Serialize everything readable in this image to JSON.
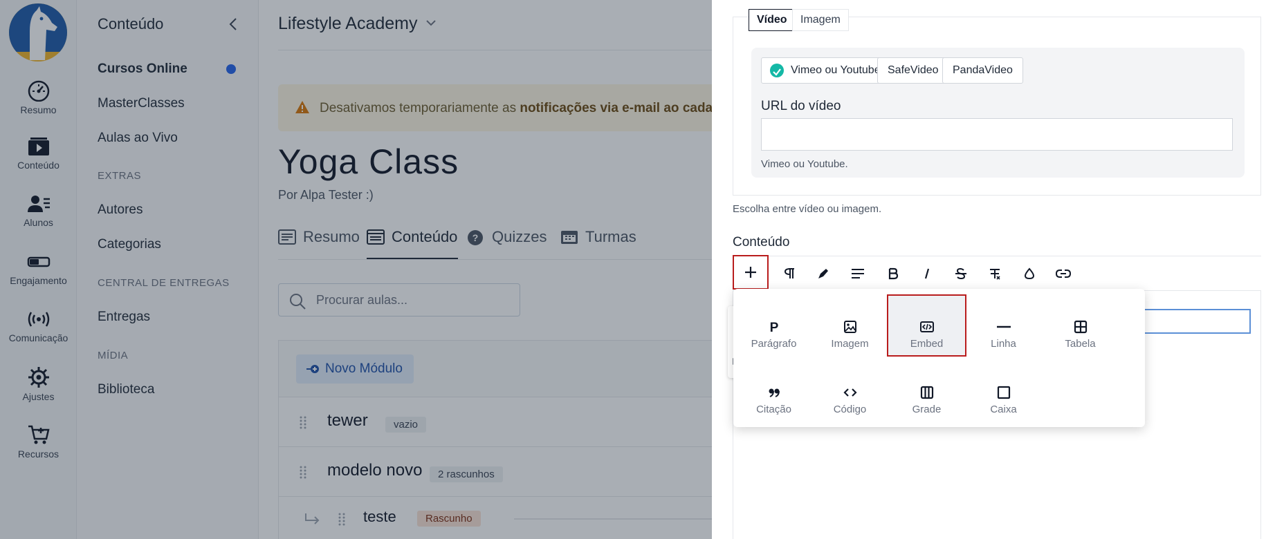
{
  "rail": {
    "items": [
      {
        "label": "Resumo",
        "icon": "gauge-icon"
      },
      {
        "label": "Conteúdo",
        "icon": "video-folder-icon"
      },
      {
        "label": "Alunos",
        "icon": "users-icon"
      },
      {
        "label": "Engajamento",
        "icon": "toggle-icon"
      },
      {
        "label": "Comunicação",
        "icon": "broadcast-icon"
      },
      {
        "label": "Ajustes",
        "icon": "gear-icon"
      },
      {
        "label": "Recursos",
        "icon": "cart-plus-icon"
      }
    ]
  },
  "sidebar": {
    "title": "Conteúdo",
    "links": [
      "Cursos Online",
      "MasterClasses",
      "Aulas ao Vivo"
    ],
    "extras_title": "EXTRAS",
    "extras": [
      "Autores",
      "Categorias"
    ],
    "central_title": "CENTRAL DE ENTREGAS",
    "central": [
      "Entregas"
    ],
    "midia_title": "MÍDIA",
    "midia": [
      "Biblioteca"
    ],
    "active_color": "#2563eb"
  },
  "main": {
    "academy": "Lifestyle Academy",
    "alert_prefix": "Desativamos temporariamente as ",
    "alert_bold": "notificações via e-mail ao cadastr",
    "course_title": "Yoga Class",
    "course_author": "Por Alpa Tester :)",
    "tabs": [
      "Resumo",
      "Conteúdo",
      "Quizzes",
      "Turmas"
    ],
    "search_placeholder": "Procurar aulas...",
    "new_module": "Novo Módulo",
    "modules": [
      {
        "name": "tewer",
        "badge": "vazio"
      },
      {
        "name": "modelo novo",
        "badge": "2 rascunhos"
      }
    ],
    "lesson": {
      "name": "teste",
      "badge": "Rascunho"
    }
  },
  "drawer": {
    "media_tabs": [
      "Vídeo",
      "Imagem"
    ],
    "providers": [
      "Vimeo ou Youtube",
      "SafeVideo",
      "PandaVideo"
    ],
    "video_label": "URL do vídeo",
    "video_value": "",
    "video_help": "Vimeo ou Youtube.",
    "media_help": "Escolha entre vídeo ou imagem.",
    "content_label": "Conteúdo",
    "block_menu": [
      {
        "label": "Parágrafo",
        "icon": "paragraph-icon"
      },
      {
        "label": "Imagem",
        "icon": "image-icon"
      },
      {
        "label": "Embed",
        "icon": "embed-icon"
      },
      {
        "label": "Linha",
        "icon": "line-icon"
      },
      {
        "label": "Tabela",
        "icon": "table-icon"
      },
      {
        "label": "Citação",
        "icon": "quote-icon"
      },
      {
        "label": "Código",
        "icon": "code-icon"
      },
      {
        "label": "Grade",
        "icon": "grid-icon"
      },
      {
        "label": "Caixa",
        "icon": "box-icon"
      }
    ],
    "highlight_color": "#b91c1c"
  }
}
